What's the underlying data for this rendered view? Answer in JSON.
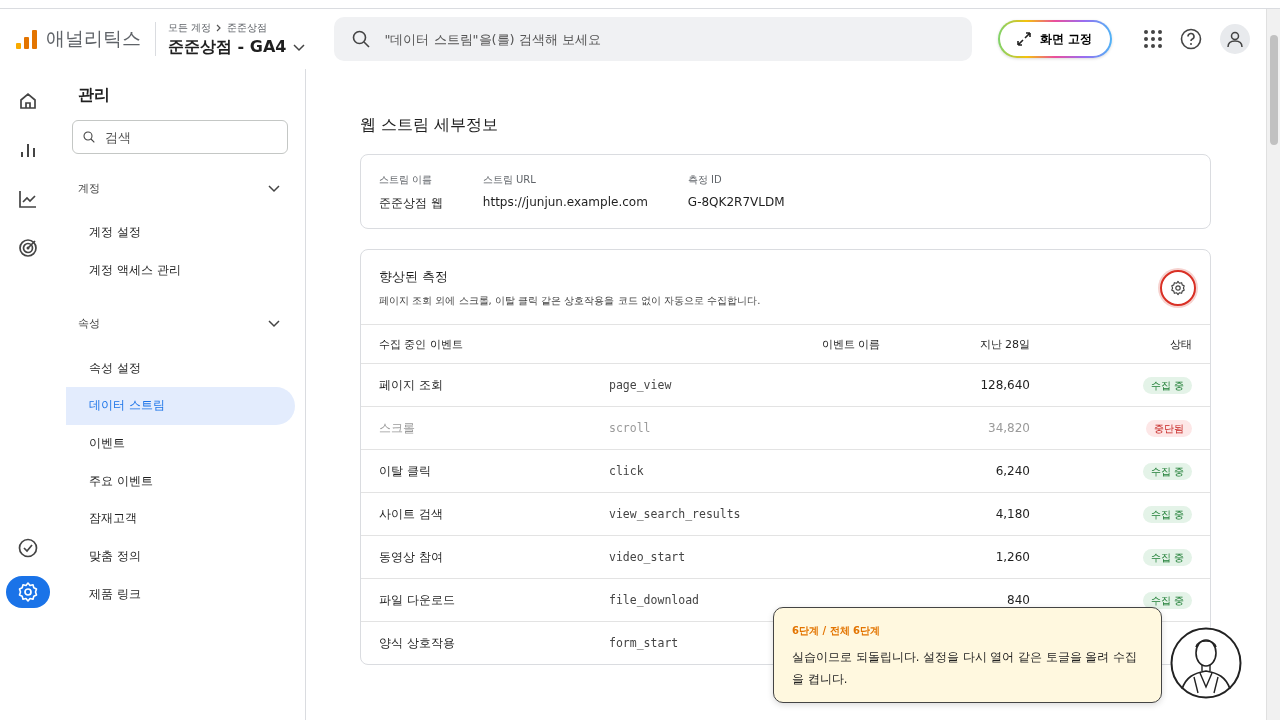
{
  "header": {
    "product": "애널리틱스",
    "breadcrumb": [
      "모든 계정",
      "준준상점"
    ],
    "property": "준준상점 - GA4",
    "search": {
      "placeholder": "\"데이터 스트림\"을(를) 검색해 보세요"
    },
    "pin_button": "화면 고정"
  },
  "rail": [
    {
      "selected": false
    },
    {
      "selected": false
    },
    {
      "selected": false
    },
    {
      "selected": false
    },
    {
      "selected": false
    },
    {
      "selected": true
    }
  ],
  "sidebar": {
    "title": "관리",
    "search": {
      "placeholder": "검색"
    },
    "sections": [
      {
        "label": "계정",
        "expanded": true,
        "items": [
          {
            "label": "계정 설정",
            "selected": false
          },
          {
            "label": "계정 액세스 관리",
            "selected": false
          }
        ]
      },
      {
        "label": "속성",
        "expanded": true,
        "items": [
          {
            "label": "속성 설정",
            "selected": false
          },
          {
            "label": "데이터 스트림",
            "selected": true
          },
          {
            "label": "이벤트",
            "selected": false
          },
          {
            "label": "주요 이벤트",
            "selected": false
          },
          {
            "label": "잠재고객",
            "selected": false
          },
          {
            "label": "맞춤 정의",
            "selected": false
          },
          {
            "label": "제품 링크",
            "selected": false
          }
        ]
      }
    ]
  },
  "page_title": "웹 스트림 세부정보",
  "stream": [
    {
      "label": "스트림 이름",
      "value": "준준상점 웹"
    },
    {
      "label": "스트림 URL",
      "value": "https://junjun.example.com"
    },
    {
      "label": "측정 ID",
      "value": "G-8QK2R7VLDM"
    }
  ],
  "enhanced": {
    "title": "향상된 측정",
    "description": "페이지 조회 외에 스크롤, 이탈 클릭 같은 상호작용을 코드 없이 자동으로 수집합니다.",
    "settings_highlighted": true,
    "columns": [
      "수집 중인 이벤트",
      "이벤트 이름",
      "지난 28일",
      "상태"
    ],
    "rows": [
      {
        "event": "페이지 조회",
        "name": "page_view",
        "count": "128,640",
        "status": "수집 중",
        "active": true
      },
      {
        "event": "스크롤",
        "name": "scroll",
        "count": "34,820",
        "status": "중단됨",
        "active": false
      },
      {
        "event": "이탈 클릭",
        "name": "click",
        "count": "6,240",
        "status": "수집 중",
        "active": true
      },
      {
        "event": "사이트 검색",
        "name": "view_search_results",
        "count": "4,180",
        "status": "수집 중",
        "active": true
      },
      {
        "event": "동영상 참여",
        "name": "video_start",
        "count": "1,260",
        "status": "수집 중",
        "active": true
      },
      {
        "event": "파일 다운로드",
        "name": "file_download",
        "count": "840",
        "status": "수집 중",
        "active": true
      },
      {
        "event": "양식 상호작용",
        "name": "form_start",
        "active": true
      }
    ]
  },
  "guide": {
    "step": "6단계 / 전체 6단계",
    "message": "실습이므로 되돌립니다. 설정을 다시 열어 같은 토글을 올려 수집을 켭니다."
  }
}
